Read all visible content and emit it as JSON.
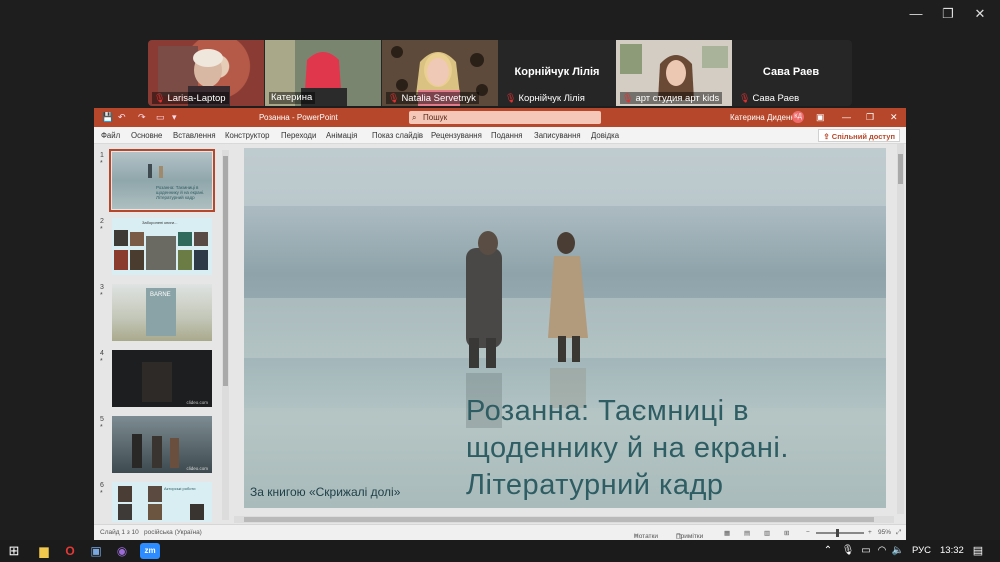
{
  "zoom_window": {
    "icons": [
      "minimize-icon",
      "restore-icon",
      "close-icon"
    ]
  },
  "participants": [
    {
      "name": "Larisa-Laptop",
      "video": true,
      "muted": true
    },
    {
      "name": "Катерина",
      "video": true,
      "muted": false,
      "active_speaker": true
    },
    {
      "name": "Natalia Servetnyk",
      "video": true,
      "muted": true
    },
    {
      "name": "Корнійчук Лілія",
      "display": "Корнійчук Лілія",
      "video": false,
      "muted": true
    },
    {
      "name": "арт студия арт kids",
      "video": true,
      "muted": true
    },
    {
      "name": "Сава Раев",
      "display": "Сава Раев",
      "video": false,
      "muted": true
    }
  ],
  "powerpoint": {
    "title": "Розанна  -  PowerPoint",
    "search_placeholder": "Пошук",
    "user_name": "Катерина Диденко",
    "user_initials": "КД",
    "menu": [
      "Файл",
      "Основне",
      "Вставлення",
      "Конструктор",
      "Переходи",
      "Анімація",
      "Показ слайдів",
      "Рецензування",
      "Подання",
      "Записування",
      "Довідка"
    ],
    "share_label": "Спільний доступ",
    "thumbnails": [
      {
        "num": "1",
        "star": "*",
        "caption": "Розанна: Таємниці в щоденнику й на екрані. Літературний кадр"
      },
      {
        "num": "2",
        "star": "*",
        "caption": "Заборонені книги..."
      },
      {
        "num": "3",
        "star": "*",
        "caption": "BARNE"
      },
      {
        "num": "4",
        "star": "*",
        "caption": "clideo.com"
      },
      {
        "num": "5",
        "star": "*",
        "caption": "clideo.com"
      },
      {
        "num": "6",
        "star": "*",
        "caption": "Акторські роботи"
      }
    ],
    "slide": {
      "title_lines": [
        "Розанна: Таємниці  в",
        "щоденнику  й  на  екрані.",
        "Літературний  кадр"
      ],
      "subtitle": "За  книгою  «Скрижалі  долі»"
    },
    "status": {
      "slide_counter": "Слайд 1 з 10",
      "language": "російська (Україна)",
      "notes": "Нотатки",
      "comments": "Примітки",
      "zoom": "95%"
    }
  },
  "taskbar": {
    "input_lang": "РУС",
    "time": "13:32",
    "apps": [
      "start-icon",
      "file-explorer-icon",
      "opera-icon",
      "app-icon",
      "viber-icon",
      "zoom-icon"
    ],
    "zoom_app_label": "zm"
  }
}
